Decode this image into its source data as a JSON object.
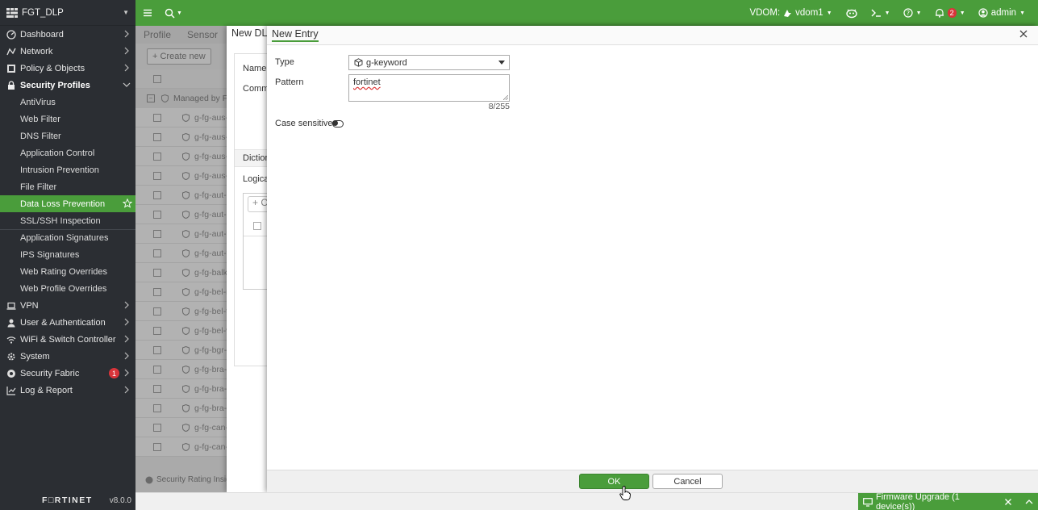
{
  "sidebar": {
    "title": "FGT_DLP",
    "items": [
      {
        "label": "Dashboard",
        "icon": "dashboard-icon"
      },
      {
        "label": "Network",
        "icon": "network-icon"
      },
      {
        "label": "Policy & Objects",
        "icon": "policy-icon"
      },
      {
        "label": "Security Profiles",
        "icon": "lock-icon"
      }
    ],
    "security_profiles_sub": [
      "AntiVirus",
      "Web Filter",
      "DNS Filter",
      "Application Control",
      "Intrusion Prevention",
      "File Filter",
      "Data Loss Prevention",
      "SSL/SSH Inspection",
      "Application Signatures",
      "IPS Signatures",
      "Web Rating Overrides",
      "Web Profile Overrides"
    ],
    "items_after": [
      {
        "label": "VPN",
        "icon": "laptop-icon"
      },
      {
        "label": "User & Authentication",
        "icon": "user-icon"
      },
      {
        "label": "WiFi & Switch Controller",
        "icon": "wifi-icon"
      },
      {
        "label": "System",
        "icon": "gear-icon"
      },
      {
        "label": "Security Fabric",
        "icon": "fabric-icon",
        "badge": "1"
      },
      {
        "label": "Log & Report",
        "icon": "chart-icon"
      }
    ],
    "footer_brand": "F□RTINET",
    "version": "v8.0.0"
  },
  "topbar": {
    "vdom_label": "VDOM:",
    "vdom_value": "vdom1",
    "alerts_count": "2",
    "user": "admin"
  },
  "background": {
    "tabs": [
      "Profile",
      "Sensor"
    ],
    "create_new": "Create new",
    "group_label": "Managed by Fo",
    "rows": [
      "g-fg-aus-ab",
      "g-fg-aus-he",
      "g-fg-aus-pa",
      "g-fg-aus-tf",
      "g-fg-aut-pa",
      "g-fg-aut-ss",
      "g-fg-aut-tii",
      "g-fg-aut-va",
      "g-fg-balkan",
      "g-fg-bel-na",
      "g-fg-bel-tii",
      "g-fg-bel-va",
      "g-fg-bgr-uc",
      "g-fg-bra-cn",
      "g-fg-bra-cp",
      "g-fg-bra-dl",
      "g-fg-can-ba",
      "g-fg-can-dl"
    ],
    "footer": "Security Rating Insigh"
  },
  "panel1": {
    "title": "New DLP",
    "name_label": "Name",
    "comments_label": "Comm",
    "dictionary_label": "Diction",
    "logical_label": "Logical",
    "mini_create": "+ C"
  },
  "panel2": {
    "title": "New Entry",
    "type_label": "Type",
    "type_value": "g-keyword",
    "pattern_label": "Pattern",
    "pattern_value": "fortinet",
    "pattern_count": "8/255",
    "case_label": "Case sensitive",
    "case_sensitive": false,
    "ok": "OK",
    "cancel": "Cancel"
  },
  "statusbar": {
    "firmware": "Firmware Upgrade (1 device(s))"
  },
  "colors": {
    "accent": "#4a9d3b",
    "sidebar": "#2b2e33",
    "badge": "#d9343a"
  }
}
